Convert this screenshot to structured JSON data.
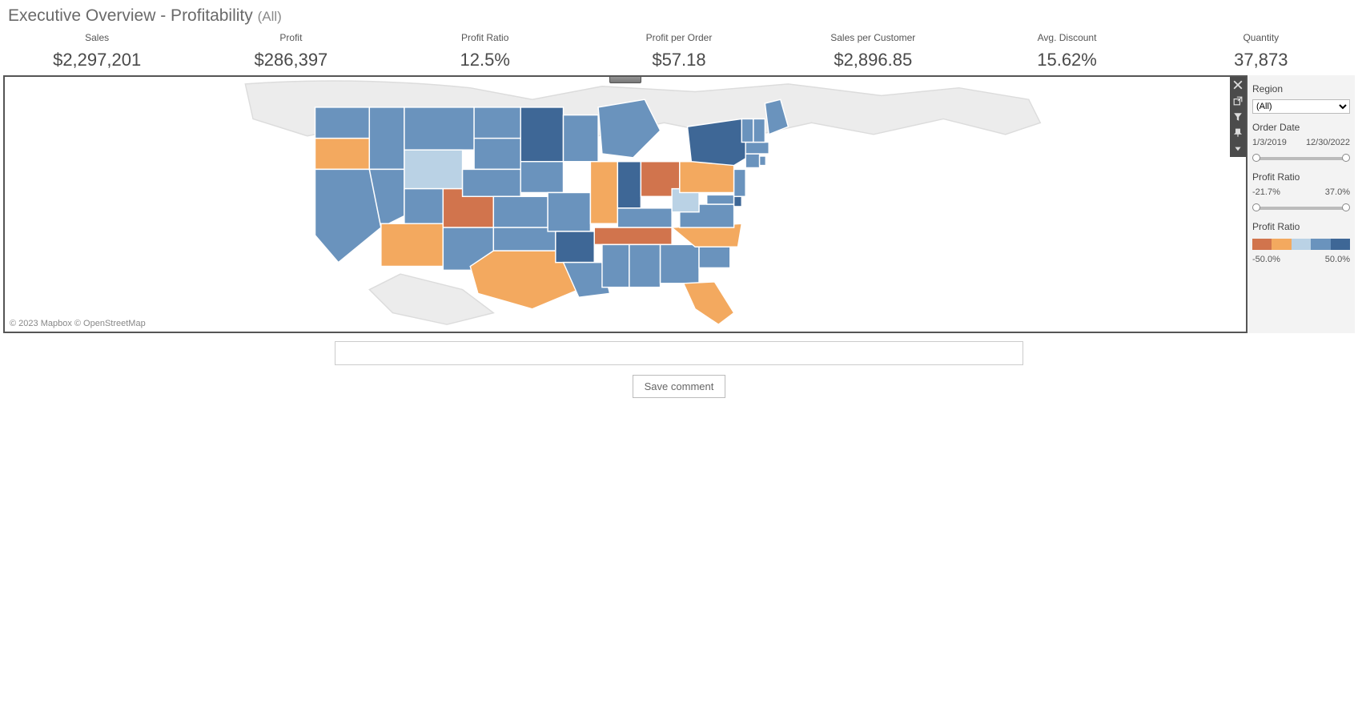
{
  "title": {
    "main": "Executive Overview - Profitability",
    "suffix": "(All)"
  },
  "kpis": [
    {
      "label": "Sales",
      "value": "$2,297,201"
    },
    {
      "label": "Profit",
      "value": "$286,397"
    },
    {
      "label": "Profit Ratio",
      "value": "12.5%"
    },
    {
      "label": "Profit per Order",
      "value": "$57.18"
    },
    {
      "label": "Sales per Customer",
      "value": "$2,896.85"
    },
    {
      "label": "Avg. Discount",
      "value": "15.62%"
    },
    {
      "label": "Quantity",
      "value": "37,873"
    }
  ],
  "map": {
    "attribution": "© 2023 Mapbox © OpenStreetMap"
  },
  "filters": {
    "region": {
      "title": "Region",
      "selected": "(All)"
    },
    "order_date": {
      "title": "Order Date",
      "start": "1/3/2019",
      "end": "12/30/2022"
    },
    "profit_ratio_range": {
      "title": "Profit Ratio",
      "min": "-21.7%",
      "max": "37.0%"
    },
    "legend": {
      "title": "Profit Ratio",
      "min": "-50.0%",
      "max": "50.0%",
      "colors": [
        "#d1744d",
        "#f3a95f",
        "#bad2e5",
        "#6a93bd",
        "#3e6796"
      ]
    }
  },
  "comment": {
    "placeholder": "",
    "button": "Save comment"
  },
  "chart_data": {
    "type": "choropleth-map",
    "region": "United States (states)",
    "metric": "Profit Ratio",
    "color_scale": {
      "min": -50.0,
      "max": 50.0,
      "unit": "%",
      "stops": [
        "#d1744d",
        "#f3a95f",
        "#bad2e5",
        "#6a93bd",
        "#3e6796"
      ]
    },
    "states": [
      {
        "state": "Washington",
        "bucket": "mid-blue",
        "approx_pct": 15
      },
      {
        "state": "Oregon",
        "bucket": "orange",
        "approx_pct": -10
      },
      {
        "state": "California",
        "bucket": "mid-blue",
        "approx_pct": 15
      },
      {
        "state": "Idaho",
        "bucket": "mid-blue",
        "approx_pct": 15
      },
      {
        "state": "Nevada",
        "bucket": "mid-blue",
        "approx_pct": 15
      },
      {
        "state": "Montana",
        "bucket": "mid-blue",
        "approx_pct": 15
      },
      {
        "state": "Wyoming",
        "bucket": "light-blue",
        "approx_pct": 3
      },
      {
        "state": "Utah",
        "bucket": "mid-blue",
        "approx_pct": 15
      },
      {
        "state": "Arizona",
        "bucket": "orange",
        "approx_pct": -10
      },
      {
        "state": "Colorado",
        "bucket": "dark-orange",
        "approx_pct": -30
      },
      {
        "state": "New Mexico",
        "bucket": "mid-blue",
        "approx_pct": 15
      },
      {
        "state": "North Dakota",
        "bucket": "mid-blue",
        "approx_pct": 15
      },
      {
        "state": "South Dakota",
        "bucket": "mid-blue",
        "approx_pct": 15
      },
      {
        "state": "Nebraska",
        "bucket": "mid-blue",
        "approx_pct": 15
      },
      {
        "state": "Kansas",
        "bucket": "mid-blue",
        "approx_pct": 15
      },
      {
        "state": "Oklahoma",
        "bucket": "mid-blue",
        "approx_pct": 15
      },
      {
        "state": "Texas",
        "bucket": "orange",
        "approx_pct": -10
      },
      {
        "state": "Minnesota",
        "bucket": "dark-blue",
        "approx_pct": 30
      },
      {
        "state": "Iowa",
        "bucket": "mid-blue",
        "approx_pct": 15
      },
      {
        "state": "Missouri",
        "bucket": "mid-blue",
        "approx_pct": 15
      },
      {
        "state": "Arkansas",
        "bucket": "dark-blue",
        "approx_pct": 30
      },
      {
        "state": "Louisiana",
        "bucket": "mid-blue",
        "approx_pct": 15
      },
      {
        "state": "Wisconsin",
        "bucket": "mid-blue",
        "approx_pct": 15
      },
      {
        "state": "Illinois",
        "bucket": "orange",
        "approx_pct": -10
      },
      {
        "state": "Michigan",
        "bucket": "mid-blue",
        "approx_pct": 15
      },
      {
        "state": "Indiana",
        "bucket": "dark-blue",
        "approx_pct": 30
      },
      {
        "state": "Ohio",
        "bucket": "dark-orange",
        "approx_pct": -30
      },
      {
        "state": "Kentucky",
        "bucket": "mid-blue",
        "approx_pct": 15
      },
      {
        "state": "Tennessee",
        "bucket": "dark-orange",
        "approx_pct": -30
      },
      {
        "state": "Mississippi",
        "bucket": "mid-blue",
        "approx_pct": 15
      },
      {
        "state": "Alabama",
        "bucket": "mid-blue",
        "approx_pct": 15
      },
      {
        "state": "Georgia",
        "bucket": "mid-blue",
        "approx_pct": 15
      },
      {
        "state": "Florida",
        "bucket": "orange",
        "approx_pct": -10
      },
      {
        "state": "South Carolina",
        "bucket": "mid-blue",
        "approx_pct": 15
      },
      {
        "state": "North Carolina",
        "bucket": "orange",
        "approx_pct": -10
      },
      {
        "state": "Virginia",
        "bucket": "mid-blue",
        "approx_pct": 15
      },
      {
        "state": "West Virginia",
        "bucket": "light-blue",
        "approx_pct": 3
      },
      {
        "state": "Maryland",
        "bucket": "mid-blue",
        "approx_pct": 15
      },
      {
        "state": "Delaware",
        "bucket": "dark-blue",
        "approx_pct": 30
      },
      {
        "state": "Pennsylvania",
        "bucket": "orange",
        "approx_pct": -10
      },
      {
        "state": "New Jersey",
        "bucket": "mid-blue",
        "approx_pct": 15
      },
      {
        "state": "New York",
        "bucket": "dark-blue",
        "approx_pct": 30
      },
      {
        "state": "Connecticut",
        "bucket": "mid-blue",
        "approx_pct": 15
      },
      {
        "state": "Rhode Island",
        "bucket": "mid-blue",
        "approx_pct": 15
      },
      {
        "state": "Massachusetts",
        "bucket": "mid-blue",
        "approx_pct": 15
      },
      {
        "state": "Vermont",
        "bucket": "mid-blue",
        "approx_pct": 15
      },
      {
        "state": "New Hampshire",
        "bucket": "mid-blue",
        "approx_pct": 15
      },
      {
        "state": "Maine",
        "bucket": "mid-blue",
        "approx_pct": 15
      }
    ]
  }
}
